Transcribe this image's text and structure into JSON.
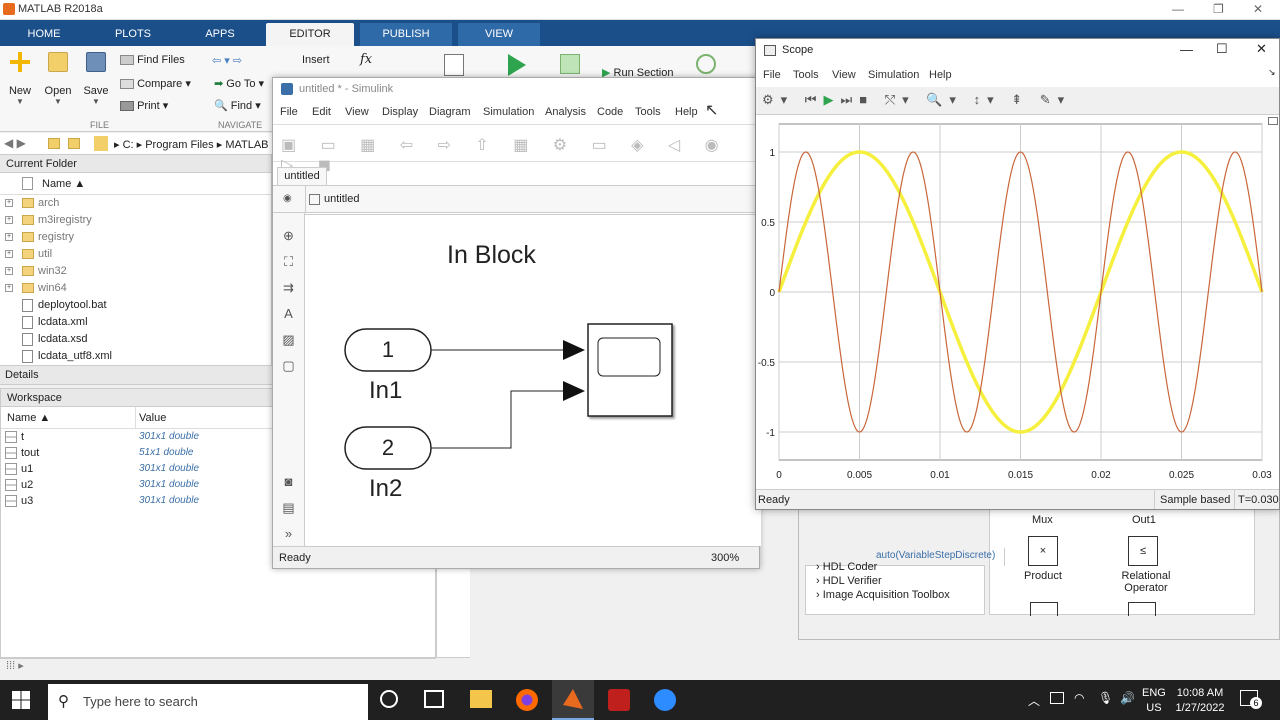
{
  "matlab": {
    "title": "MATLAB R2018a",
    "tabs": [
      "HOME",
      "PLOTS",
      "APPS",
      "EDITOR",
      "PUBLISH",
      "VIEW"
    ],
    "ribbon": {
      "new": "New",
      "open": "Open",
      "save": "Save",
      "find_files": "Find Files",
      "compare": "Compare",
      "print": "Print",
      "go_to": "Go To",
      "find": "Find",
      "insert": "Insert",
      "fx": "fx",
      "run_section": "Run Section",
      "file_section": "FILE",
      "navigate_section": "NAVIGATE"
    },
    "address": {
      "drive": "C:",
      "p1": "Program Files",
      "p2": "MATLAB"
    },
    "current_folder": {
      "title": "Current Folder",
      "col_name": "Name",
      "items": [
        {
          "name": "arch",
          "type": "folder"
        },
        {
          "name": "m3iregistry",
          "type": "folder"
        },
        {
          "name": "registry",
          "type": "folder"
        },
        {
          "name": "util",
          "type": "folder"
        },
        {
          "name": "win32",
          "type": "folder"
        },
        {
          "name": "win64",
          "type": "folder"
        },
        {
          "name": "deploytool.bat",
          "type": "file"
        },
        {
          "name": "lcdata.xml",
          "type": "file"
        },
        {
          "name": "lcdata.xsd",
          "type": "file"
        },
        {
          "name": "lcdata_utf8.xml",
          "type": "file"
        }
      ]
    },
    "details_label": "Details",
    "workspace": {
      "title": "Workspace",
      "col_name": "Name",
      "col_value": "Value",
      "rows": [
        {
          "name": "t",
          "value": "301x1 double"
        },
        {
          "name": "tout",
          "value": "51x1 double"
        },
        {
          "name": "u1",
          "value": "301x1 double"
        },
        {
          "name": "u2",
          "value": "301x1 double"
        },
        {
          "name": "u3",
          "value": "301x1 double"
        }
      ]
    }
  },
  "simulink": {
    "title": "untitled * - Simulink",
    "menu": [
      "File",
      "Edit",
      "View",
      "Display",
      "Diagram",
      "Simulation",
      "Analysis",
      "Code",
      "Tools",
      "Help"
    ],
    "tab": "untitled",
    "breadcrumb": "untitled",
    "annotation": "In Block",
    "in1_num": "1",
    "in1_label": "In1",
    "in2_num": "2",
    "in2_label": "In2",
    "status_ready": "Ready",
    "zoom": "300%",
    "solver": "auto(VariableStepDiscrete)"
  },
  "scope": {
    "title": "Scope",
    "menu": [
      "File",
      "Tools",
      "View",
      "Simulation",
      "Help"
    ],
    "status_ready": "Ready",
    "sample_based": "Sample based",
    "time": "T=0.030"
  },
  "library": {
    "items": [
      "HDL Coder",
      "HDL Verifier",
      "Image Acquisition Toolbox"
    ],
    "blocks": {
      "mux": "Mux",
      "out1": "Out1",
      "product": "Product",
      "relational": "Relational Operator"
    }
  },
  "taskbar": {
    "search_placeholder": "Type here to search",
    "lang1": "ENG",
    "lang2": "US",
    "time": "10:08 AM",
    "date": "1/27/2022",
    "notif": "6"
  },
  "chart_data": {
    "type": "line",
    "title": "",
    "xlim": [
      0,
      0.03
    ],
    "ylim": [
      -1.2,
      1.2
    ],
    "xticks": [
      "0",
      "0.005",
      "0.01",
      "0.015",
      "0.02",
      "0.025",
      "0.03"
    ],
    "yticks": [
      "1",
      "0.5",
      "0",
      "-0.5",
      "-1"
    ],
    "grid": true,
    "series": [
      {
        "color": "#f5ef3d",
        "amplitude": 1,
        "frequency_hz": 50,
        "function": "sin"
      },
      {
        "color": "#c9663a",
        "amplitude": 1,
        "frequency_hz": 150,
        "function": "sin"
      }
    ]
  }
}
